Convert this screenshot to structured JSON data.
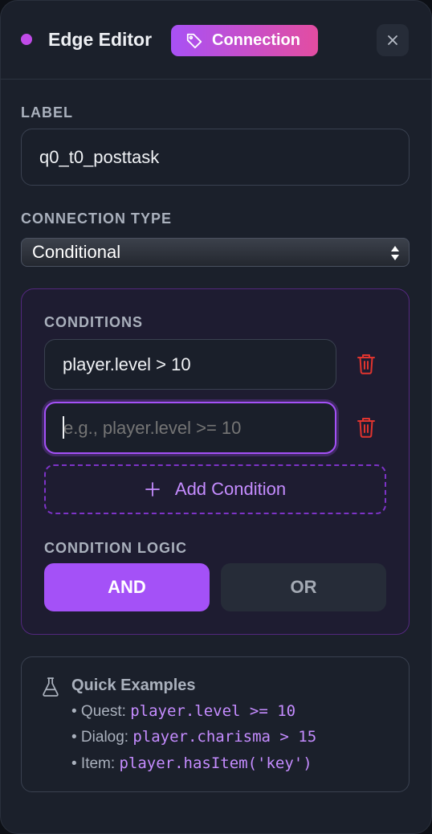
{
  "header": {
    "title": "Edge Editor",
    "badge_label": "Connection",
    "accent_dot_color": "#c04be8",
    "badge_gradient": [
      "#a851f5",
      "#e34da1"
    ]
  },
  "label_field": {
    "label": "LABEL",
    "value": "q0_t0_posttask"
  },
  "connection_type": {
    "label": "CONNECTION TYPE",
    "selected": "Conditional"
  },
  "conditions": {
    "label": "CONDITIONS",
    "items": [
      {
        "value": "player.level > 10",
        "placeholder": ""
      },
      {
        "value": "",
        "placeholder": "e.g., player.level >= 10"
      }
    ],
    "add_label": "Add Condition",
    "logic_label": "CONDITION LOGIC",
    "logic_options": [
      "AND",
      "OR"
    ],
    "logic_selected": "AND"
  },
  "examples": {
    "title": "Quick Examples",
    "items": [
      {
        "prefix": "• Quest: ",
        "code": "player.level >= 10"
      },
      {
        "prefix": "• Dialog: ",
        "code": "player.charisma > 15"
      },
      {
        "prefix": "• Item: ",
        "code": "player.hasItem('key')"
      }
    ]
  },
  "icons": [
    "tag-icon",
    "close-icon",
    "select-arrows-icon",
    "trash-icon",
    "plus-icon",
    "flask-icon"
  ],
  "colors": {
    "accent": "#a451f7",
    "code": "#c58cff",
    "danger": "#e0342f"
  }
}
